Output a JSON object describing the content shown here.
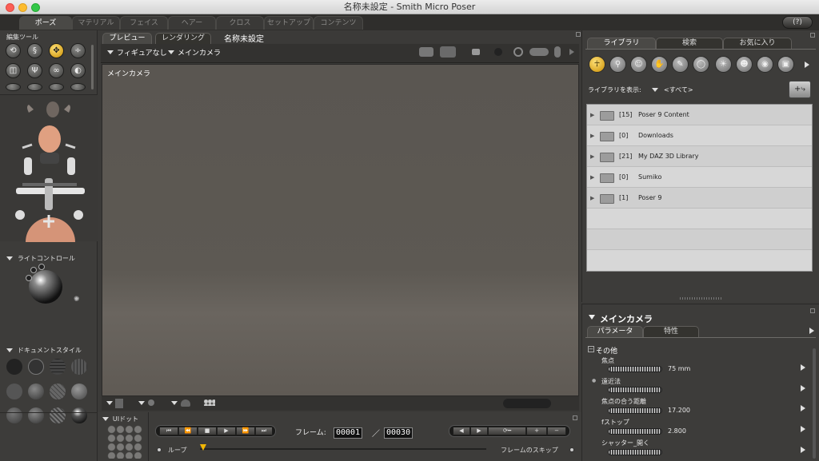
{
  "window": {
    "title": "名称未設定 - Smith Micro Poser"
  },
  "rooms": [
    "ポーズ",
    "マテリアル",
    "フェイス",
    "ヘアー",
    "クロス",
    "セットアップ",
    "コンテンツ"
  ],
  "left": {
    "editing_tools_label": "編集ツール",
    "light_controls_label": "ライトコントロール",
    "document_style_label": "ドキュメントスタイル",
    "ui_dot_label": "UIドット"
  },
  "doc": {
    "tabs": [
      "プレビュー",
      "レンダリング"
    ],
    "doc_title": "名称未設定",
    "figure_select": "フィギュアなし",
    "camera_select": "メインカメラ",
    "viewport_camera_label": "メインカメラ"
  },
  "animation": {
    "frame_label": "フレーム:",
    "current_frame": "00001",
    "separator": "／",
    "total_frames": "00030",
    "loop_label": "ループ",
    "skip_frames_label": "フレームのスキップ"
  },
  "library": {
    "tabs": [
      "ライブラリ",
      "検索",
      "お気に入り"
    ],
    "show_label": "ライブラリを表示:",
    "show_value": "<すべて>",
    "items": [
      {
        "count": "[15]",
        "name": "Poser 9 Content"
      },
      {
        "count": "[0]",
        "name": "Downloads"
      },
      {
        "count": "[21]",
        "name": "My DAZ 3D Library"
      },
      {
        "count": "[0]",
        "name": "Sumiko"
      },
      {
        "count": "[1]",
        "name": "Poser 9"
      }
    ],
    "icons": [
      "figure-icon",
      "pose-icon",
      "face-icon",
      "hand-icon",
      "hair-icon",
      "prop-icon",
      "light-icon",
      "group-icon",
      "materials-icon",
      "camera-icon"
    ]
  },
  "params": {
    "title": "メインカメラ",
    "tabs": [
      "パラメータ",
      "特性"
    ],
    "group": "その他",
    "rows": [
      {
        "label": "焦点",
        "value": "75 mm"
      },
      {
        "label": "遠近法",
        "value": ""
      },
      {
        "label": "焦点の合う距離",
        "value": "17.200"
      },
      {
        "label": "fストップ",
        "value": "2.800"
      },
      {
        "label": "シャッター_開く",
        "value": ""
      }
    ]
  },
  "colors": {
    "accent": "#f2b705",
    "panel": "#3d3c3a",
    "viewport": "#5b5751"
  }
}
